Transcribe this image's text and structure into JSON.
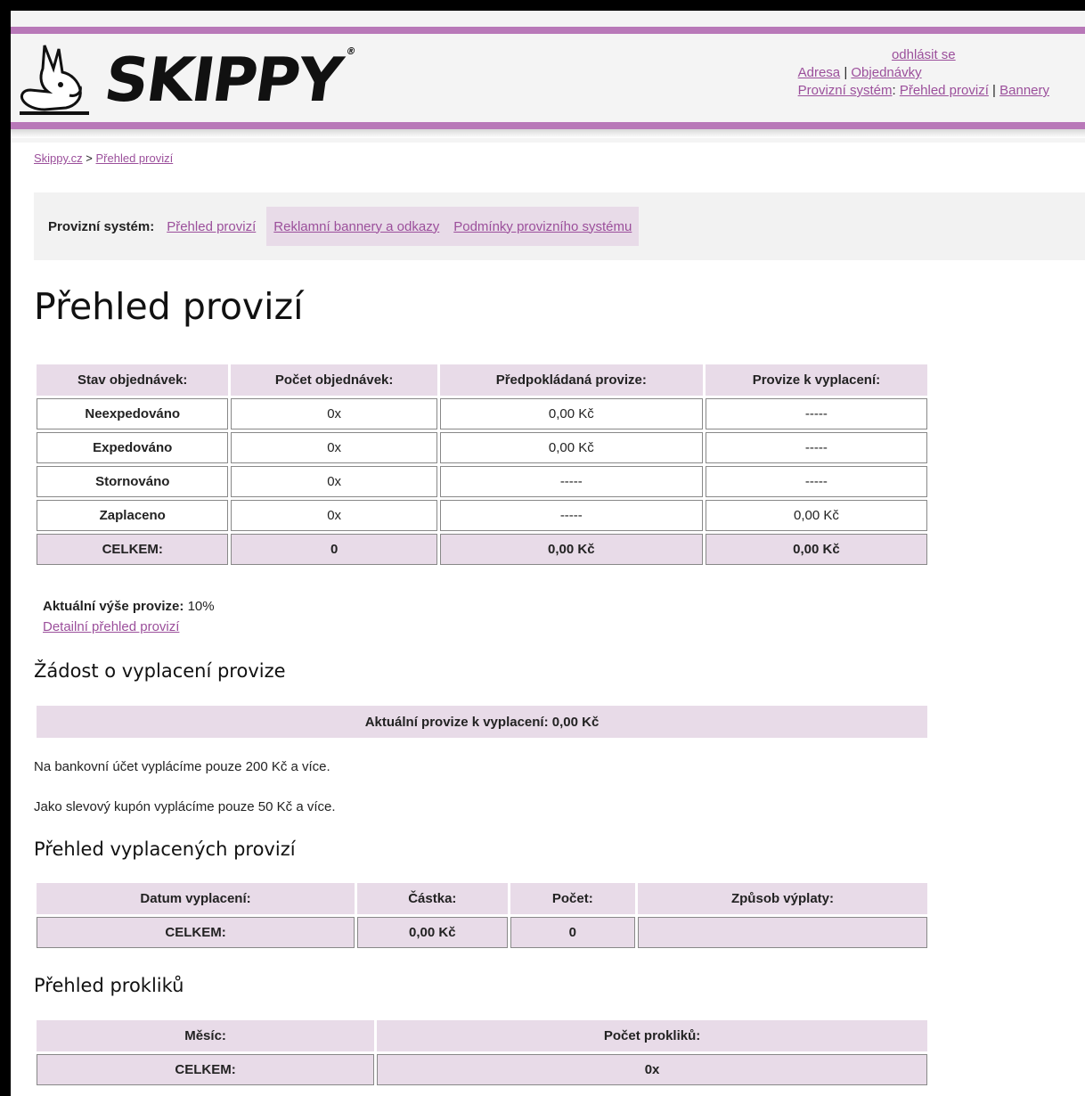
{
  "header": {
    "logo_text": "SKIPPY",
    "logo_mark": "®",
    "logout_link": "odhlásit se",
    "address_link": "Adresa",
    "orders_link": "Objednávky",
    "commission_system_link": "Provizní systém",
    "overview_link": "Přehled provizí",
    "banners_link": "Bannery",
    "separator": "|",
    "colon": ":"
  },
  "breadcrumb": {
    "home": "Skippy.cz",
    "separator": ">",
    "current": "Přehled provizí"
  },
  "subnav": {
    "label": "Provizní systém:",
    "items": [
      "Přehled provizí",
      "Reklamní bannery a odkazy",
      "Podmínky provizního systému"
    ]
  },
  "page_title": "Přehled provizí",
  "orders_table": {
    "headers": [
      "Stav objednávek:",
      "Počet objednávek:",
      "Předpokládaná provize:",
      "Provize k vyplacení:"
    ],
    "rows": [
      [
        "Neexpedováno",
        "0x",
        "0,00 Kč",
        "-----"
      ],
      [
        "Expedováno",
        "0x",
        "0,00 Kč",
        "-----"
      ],
      [
        "Stornováno",
        "0x",
        "-----",
        "-----"
      ],
      [
        "Zaplaceno",
        "0x",
        "-----",
        "0,00 Kč"
      ]
    ],
    "total": [
      "CELKEM:",
      "0",
      "0,00 Kč",
      "0,00 Kč"
    ]
  },
  "current_rate_label": "Aktuální výše provize:",
  "current_rate_value": "10%",
  "detail_link": "Detailní přehled provizí",
  "payout_request": {
    "heading": "Žádost o vyplacení provize",
    "bar_text": "Aktuální provize k vyplacení: 0,00 Kč",
    "bank_note": "Na bankovní účet vyplácíme pouze 200 Kč a více.",
    "coupon_note": "Jako slevový kupón vyplácíme pouze 50 Kč a více."
  },
  "payouts_table": {
    "heading": "Přehled vyplacených provizí",
    "headers": [
      "Datum vyplacení:",
      "Částka:",
      "Počet:",
      "Způsob výplaty:"
    ],
    "total": [
      "CELKEM:",
      "0,00 Kč",
      "0",
      ""
    ]
  },
  "clicks_table": {
    "heading": "Přehled prokliků",
    "headers": [
      "Měsíc:",
      "Počet prokliků:"
    ],
    "total": [
      "CELKEM:",
      "0x"
    ]
  },
  "colors": {
    "accent": "#b878b8",
    "link": "#9b4f9b",
    "header_cell": "#e8dbe8"
  },
  "icons": {
    "logo": "kangaroo-icon"
  }
}
